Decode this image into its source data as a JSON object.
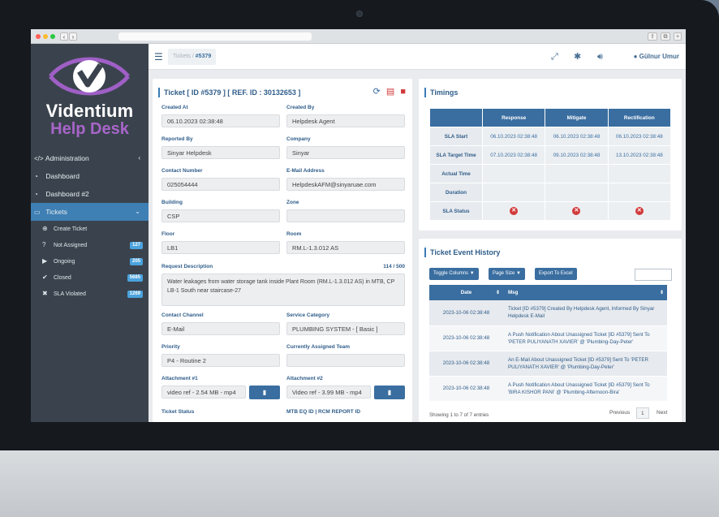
{
  "brand": {
    "name": "Videntium",
    "sub": "Help Desk"
  },
  "sidebar": {
    "items": [
      {
        "label": "Administration",
        "icon": "code-icon"
      },
      {
        "label": "Dashboard",
        "icon": "dashboard-icon"
      },
      {
        "label": "Dashboard #2",
        "icon": "dashboard-icon"
      },
      {
        "label": "Tickets",
        "icon": "ticket-icon"
      }
    ],
    "subitems": [
      {
        "label": "Create Ticket",
        "icon": "plus-circle-icon",
        "badge": ""
      },
      {
        "label": "Not Assigned",
        "icon": "question-circle-icon",
        "badge": "127"
      },
      {
        "label": "Ongoing",
        "icon": "play-circle-icon",
        "badge": "205"
      },
      {
        "label": "Closed",
        "icon": "check-circle-icon",
        "badge": "5685"
      },
      {
        "label": "SLA Violated",
        "icon": "x-circle-icon",
        "badge": "1269"
      }
    ]
  },
  "topbar": {
    "crumb_root": "Tickets",
    "crumb_sep": "/",
    "crumb_current": "#5379",
    "user": "Gülnur Umur"
  },
  "ticket": {
    "title": "Ticket [ ID #5379 ] [ REF. ID : 30132653 ]",
    "fields": {
      "created_at": {
        "label": "Created At",
        "value": "06.10.2023 02:38:48"
      },
      "created_by": {
        "label": "Created By",
        "value": "Helpdesk Agent"
      },
      "reported_by": {
        "label": "Reported By",
        "value": "Sinyar Helpdesk"
      },
      "company": {
        "label": "Company",
        "value": "Sinyar"
      },
      "contact_number": {
        "label": "Contact Number",
        "value": "025054444"
      },
      "email": {
        "label": "E-Mail Address",
        "value": "HelpdeskAFM@sinyaruae.com"
      },
      "building": {
        "label": "Building",
        "value": "CSP"
      },
      "zone": {
        "label": "Zone",
        "value": ""
      },
      "floor": {
        "label": "Floor",
        "value": "LB1"
      },
      "room": {
        "label": "Room",
        "value": "RM.L-1.3.012 AS"
      },
      "request_description": {
        "label": "Request Description",
        "counter": "114 / 500",
        "value": "Water leakages from water storage tank inside Plant Room (RM.L-1.3.012 AS) in MTB, CP LB-1 South near staircase-27"
      },
      "contact_channel": {
        "label": "Contact Channel",
        "value": "E-Mail"
      },
      "service_category": {
        "label": "Service Category",
        "value": "PLUMBING SYSTEM - [ Basic ]"
      },
      "priority": {
        "label": "Priority",
        "value": "P4 - Routine 2"
      },
      "assigned_team": {
        "label": "Currently Assigned Team",
        "value": ""
      },
      "attachment1": {
        "label": "Attachment #1",
        "value": "video ref - 2.54 MB - mp4"
      },
      "attachment2": {
        "label": "Attachment #2",
        "value": "Video ref - 3.99 MB - mp4"
      },
      "ticket_status": {
        "label": "Ticket Status"
      },
      "mtb_eq": {
        "label": "MTB EQ ID | RCM REPORT ID"
      }
    }
  },
  "timings": {
    "title": "Timings",
    "columns": [
      "Response",
      "Mitigate",
      "Rectification"
    ],
    "rows": [
      {
        "label": "SLA Start",
        "values": [
          "06.10.2023 02:38:48",
          "06.10.2023 02:38:48",
          "06.10.2023 02:38:48"
        ]
      },
      {
        "label": "SLA Target Time",
        "values": [
          "07.10.2023 02:38:48",
          "09.10.2023 02:38:48",
          "13.10.2023 02:38:48"
        ]
      },
      {
        "label": "Actual Time",
        "values": [
          "",
          "",
          ""
        ]
      },
      {
        "label": "Duration",
        "values": [
          "",
          "",
          ""
        ]
      },
      {
        "label": "SLA Status",
        "values": [
          "✕",
          "✕",
          "✕"
        ]
      }
    ]
  },
  "history": {
    "title": "Ticket Event History",
    "buttons": [
      "Toggle Columns ▼",
      "Page Size ▼",
      "Export To Excel"
    ],
    "columns": [
      "Date",
      "Msg"
    ],
    "rows": [
      {
        "date": "2023-10-06 02:38:48",
        "msg": "Ticket [ID #5379] Created By Helpdesk Agent, Informed By Sinyar Helpdesk E-Mail"
      },
      {
        "date": "2023-10-06 02:38:48",
        "msg": "A Push Notification About Unassigned Ticket [ID #5379] Sent To 'PETER PULIYANATH XAVIER' @ 'Plumbing-Day-Peter'"
      },
      {
        "date": "2023-10-06 02:38:48",
        "msg": "An E-Mail About Unassigned Ticket [ID #5379] Sent To 'PETER PULIYANATH XAVIER' @ 'Plumbing-Day-Peter'"
      },
      {
        "date": "2023-10-06 02:38:48",
        "msg": "A Push Notification About Unassigned Ticket [ID #5379] Sent To 'BIRA KISHOR PANI' @ 'Plumbing-Afternoon-Bira'"
      }
    ],
    "footer": "Showing 1 to 7 of 7 entries",
    "pager": {
      "previous": "Previous",
      "current": "1",
      "next": "Next"
    }
  }
}
